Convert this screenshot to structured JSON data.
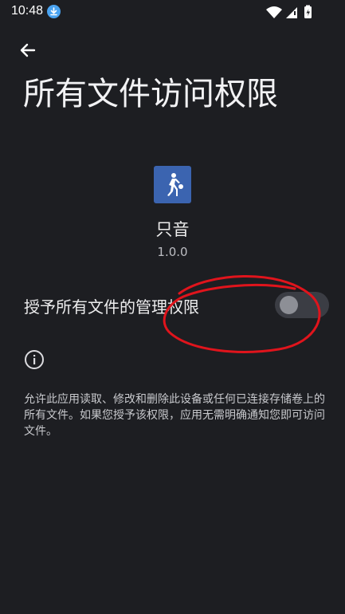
{
  "status_bar": {
    "time": "10:48",
    "icons": [
      "download-icon",
      "wifi-icon",
      "signal-icon",
      "battery-icon"
    ]
  },
  "header": {
    "back_icon": "arrow-left-icon",
    "title": "所有文件访问权限"
  },
  "app": {
    "name": "只音",
    "version": "1.0.0",
    "icon_color": "#3b64b0"
  },
  "permission": {
    "label": "授予所有文件的管理权限",
    "enabled": false
  },
  "info": {
    "icon": "info-icon",
    "description": "允许此应用读取、修改和删除此设备或任何已连接存储卷上的所有文件。如果您授予该权限，应用无需明确通知您即可访问文件。"
  },
  "colors": {
    "background": "#1d1e22",
    "annotation": "#e0141c",
    "switch_track": "#3b3d44",
    "switch_thumb": "#8d8f96"
  }
}
